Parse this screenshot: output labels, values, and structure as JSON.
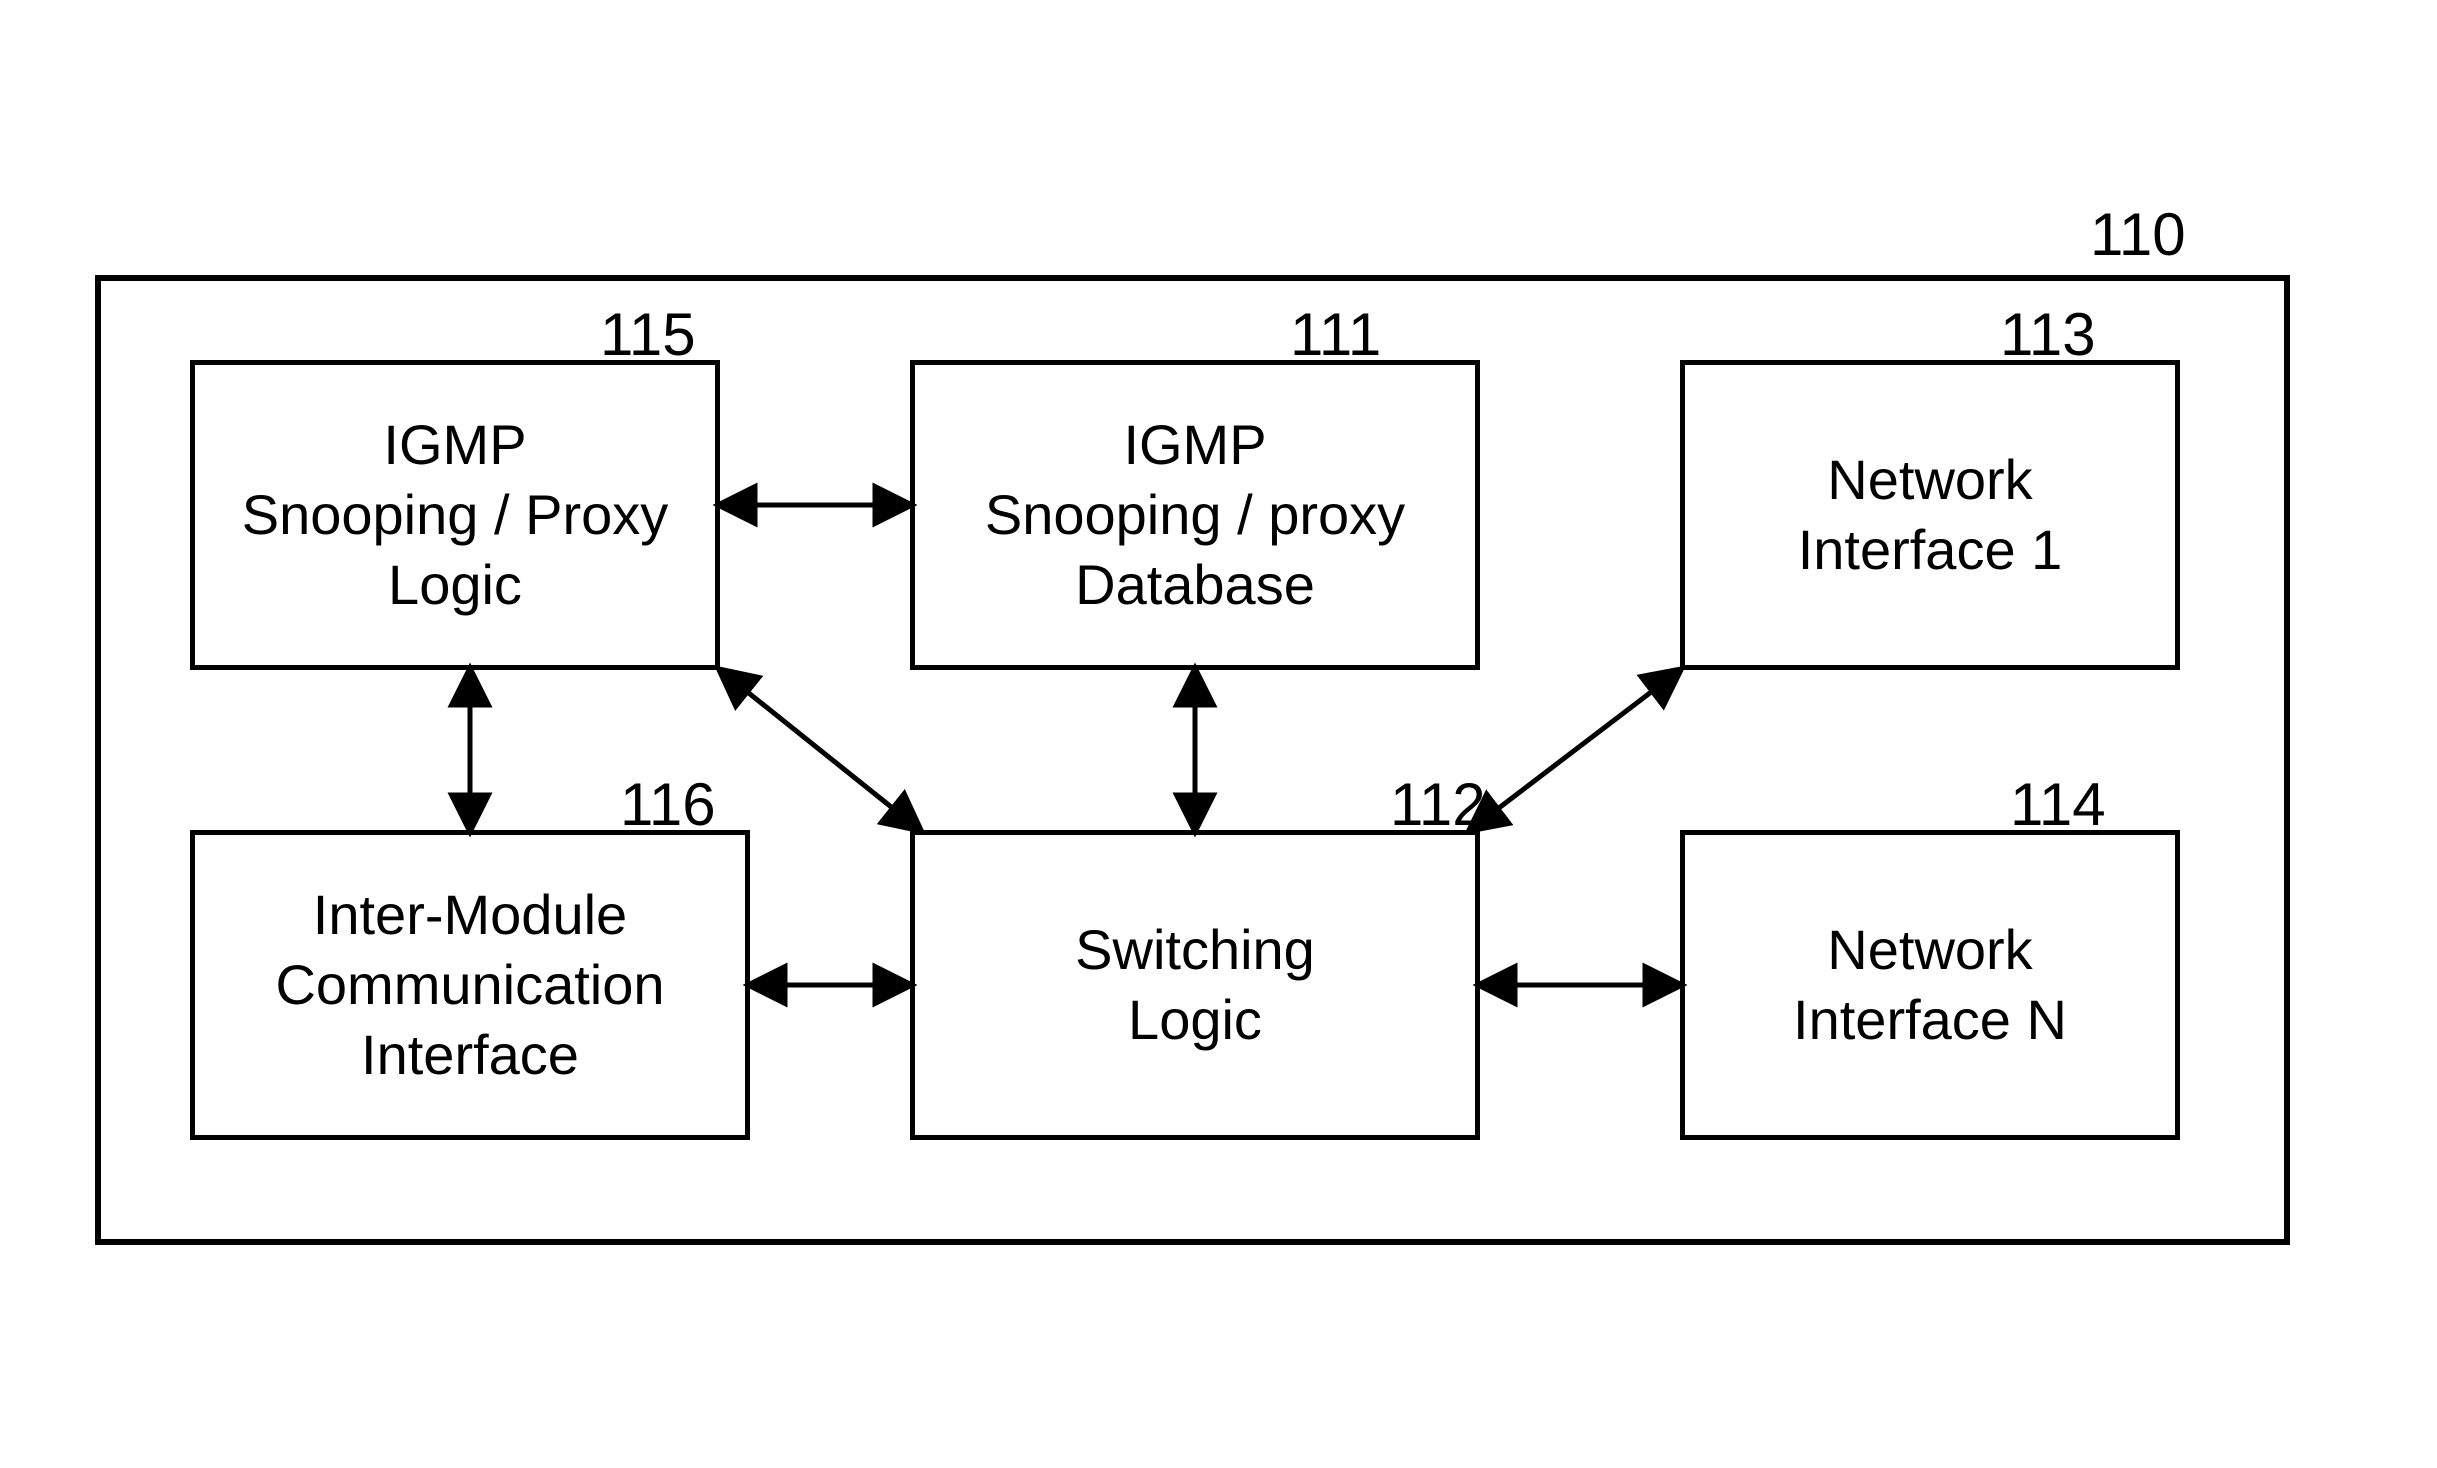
{
  "diagram": {
    "outer_ref": "110",
    "boxes": {
      "igmp_logic": {
        "ref": "115",
        "label": "IGMP\nSnooping / Proxy\nLogic"
      },
      "igmp_db": {
        "ref": "111",
        "label": "IGMP\nSnooping / proxy\nDatabase"
      },
      "net_if_1": {
        "ref": "113",
        "label": "Network\nInterface 1"
      },
      "inter_module": {
        "ref": "116",
        "label": "Inter-Module\nCommunication\nInterface"
      },
      "switching": {
        "ref": "112",
        "label": "Switching\nLogic"
      },
      "net_if_n": {
        "ref": "114",
        "label": "Network\nInterface N"
      }
    }
  }
}
